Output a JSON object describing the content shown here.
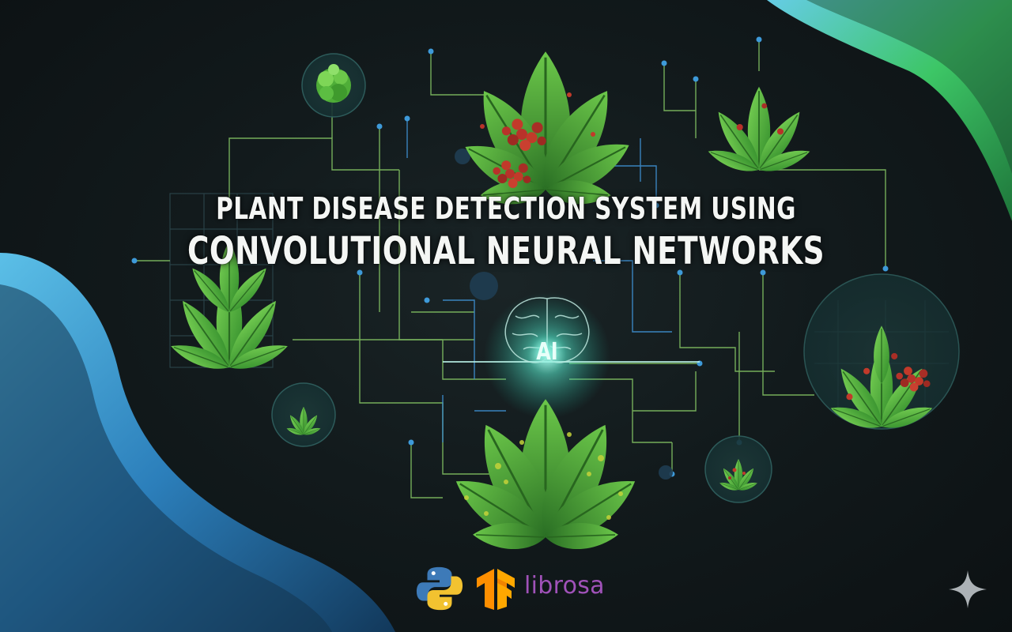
{
  "title": {
    "line1": "PLANT DISEASE DETECTION SYSTEM USING",
    "line2": "CONVOLUTIONAL NEURAL NETWORKS"
  },
  "center_badge": {
    "label": "AI",
    "icon": "brain-icon"
  },
  "logos": {
    "python_icon": "python-logo",
    "tensorflow_icon": "tensorflow-logo",
    "librosa_text": "librosa"
  },
  "watermark_icon": "sparkle-icon",
  "colors": {
    "background": "#10171a",
    "circuit": "#8bd06a",
    "circuit_blue": "#3e9ad9",
    "leaf_green": "#52b43c",
    "leaf_dark": "#2f7a26",
    "disease_red": "#c23a2a",
    "wave_blue": "#3aa6e0",
    "wave_green": "#56e06a",
    "glow": "#7ff5e0",
    "librosa_purple": "#a052b9"
  }
}
